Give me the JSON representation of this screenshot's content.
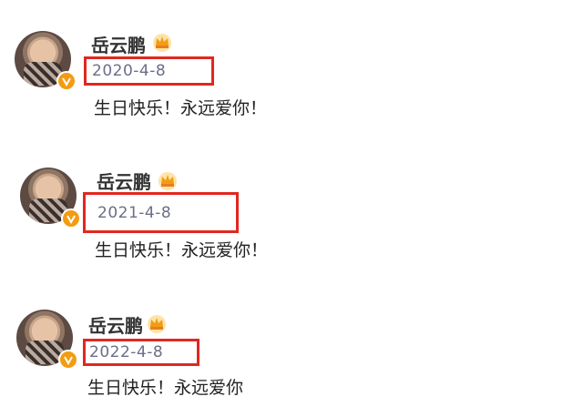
{
  "posts": [
    {
      "author": "岳云鹏",
      "date": "2020-4-8",
      "text": "生日快乐！永远爱你！"
    },
    {
      "author": "岳云鹏",
      "date": "2021-4-8",
      "text": "生日快乐！永远爱你！"
    },
    {
      "author": "岳云鹏",
      "date": "2022-4-8",
      "text": "生日快乐！永远爱你"
    }
  ],
  "colors": {
    "highlight_box": "#e1281f",
    "verified_badge": "#f39c12",
    "date_text": "#6b6f86"
  },
  "icons": {
    "verified": "verified-v-icon",
    "member": "crown-icon"
  }
}
